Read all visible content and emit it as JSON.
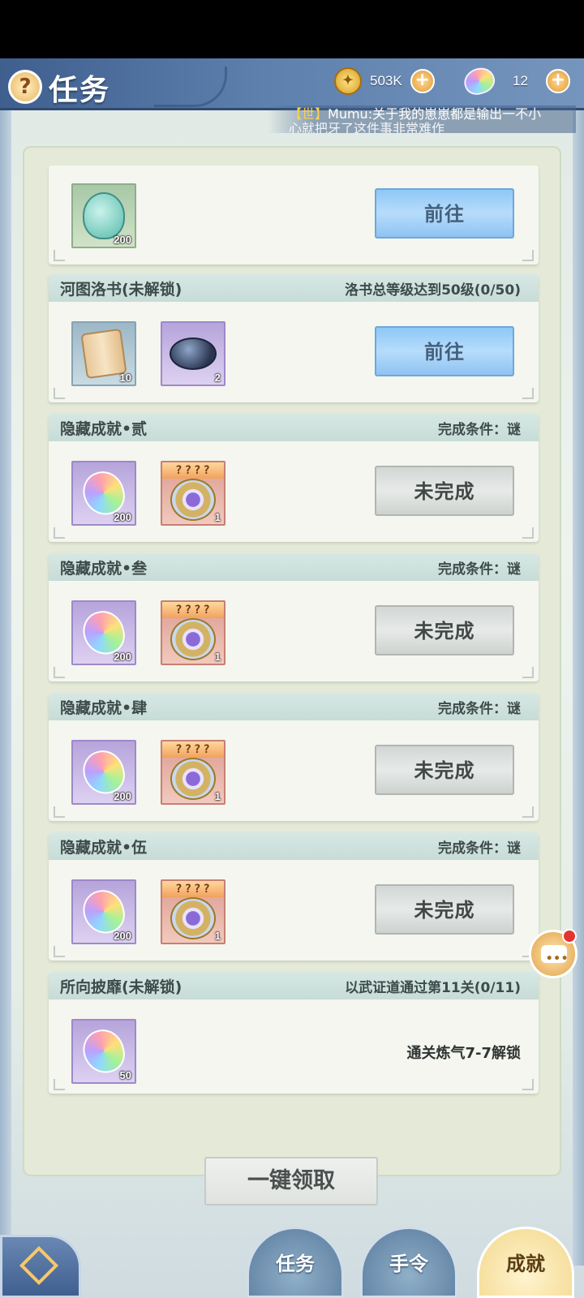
{
  "header": {
    "help_symbol": "?",
    "title": "任务",
    "coins": "503K",
    "gems": "12",
    "plus_symbol": "+"
  },
  "ticker": {
    "tag": "【世】",
    "message": "Mumu:关于我的崽崽都是输出一不小",
    "message_line2": "心就把牙了这件事非常难作"
  },
  "cards": [
    {
      "header": null,
      "rewards": [
        {
          "icon": "jade-pendant-icon",
          "count": "200"
        }
      ],
      "button": "前往"
    },
    {
      "header": {
        "title": "河图洛书(未解锁)",
        "condition": "洛书总等级达到50级(0/50)"
      },
      "rewards": [
        {
          "icon": "scroll-icon",
          "count": "10"
        },
        {
          "icon": "black-stone-icon",
          "count": "2"
        }
      ],
      "button": "前往"
    },
    {
      "header": {
        "title": "隐藏成就•贰",
        "condition": "完成条件：谜"
      },
      "rewards": [
        {
          "icon": "rainbow-gem-icon",
          "count": "200"
        },
        {
          "icon": "mystery-emblem-icon",
          "count": "1",
          "mark": "????"
        }
      ],
      "button": "未完成"
    },
    {
      "header": {
        "title": "隐藏成就•叁",
        "condition": "完成条件：谜"
      },
      "rewards": [
        {
          "icon": "rainbow-gem-icon",
          "count": "200"
        },
        {
          "icon": "mystery-emblem-icon",
          "count": "1",
          "mark": "????"
        }
      ],
      "button": "未完成"
    },
    {
      "header": {
        "title": "隐藏成就•肆",
        "condition": "完成条件：谜"
      },
      "rewards": [
        {
          "icon": "rainbow-gem-icon",
          "count": "200"
        },
        {
          "icon": "mystery-emblem-icon",
          "count": "1",
          "mark": "????"
        }
      ],
      "button": "未完成"
    },
    {
      "header": {
        "title": "隐藏成就•伍",
        "condition": "完成条件：谜"
      },
      "rewards": [
        {
          "icon": "rainbow-gem-icon",
          "count": "200"
        },
        {
          "icon": "mystery-emblem-icon",
          "count": "1",
          "mark": "????"
        }
      ],
      "button": "未完成"
    },
    {
      "header": {
        "title": "所向披靡(未解锁)",
        "condition": "以武证道通过第11关(0/11)"
      },
      "rewards": [
        {
          "icon": "rainbow-gem-icon",
          "count": "50"
        }
      ],
      "unlock_text": "通关炼气7-7解锁"
    }
  ],
  "claim_all": "一键领取",
  "tabs": [
    {
      "label": "任务",
      "active": false
    },
    {
      "label": "手令",
      "active": false
    },
    {
      "label": "成就",
      "active": true
    }
  ],
  "colors": {
    "header_blue": "#5d80ad",
    "go_button": "#8ec8f6",
    "todo_button": "#d2d6d4",
    "card_header": "#d7e8e4",
    "notification_red": "#e3352e"
  }
}
